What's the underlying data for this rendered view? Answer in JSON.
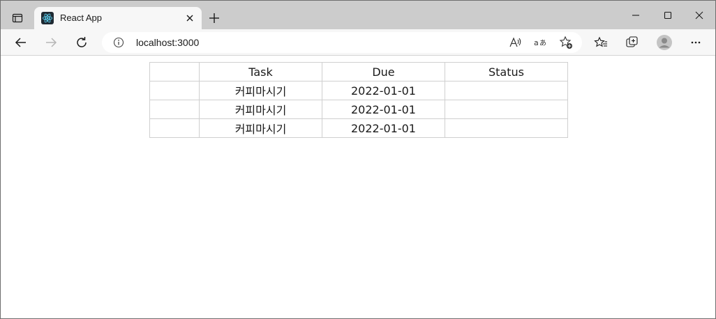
{
  "browser": {
    "tab": {
      "title": "React App",
      "favicon": "react-logo-icon"
    },
    "address": {
      "url": "localhost:3000"
    },
    "accent": "#61dafb",
    "icons": [
      "tab-actions-icon",
      "close-icon",
      "plus-icon",
      "minimize-icon",
      "maximize-icon",
      "window-close-icon",
      "back-icon",
      "forward-icon",
      "refresh-icon",
      "info-icon",
      "read-aloud-icon",
      "translate-icon",
      "add-favorite-icon",
      "favorites-icon",
      "collections-icon",
      "profile-icon",
      "more-icon"
    ]
  },
  "table": {
    "headers": [
      "",
      "Task",
      "Due",
      "Status"
    ],
    "rows": [
      {
        "col0": "",
        "task": "커피마시기",
        "due": "2022-01-01",
        "status": ""
      },
      {
        "col0": "",
        "task": "커피마시기",
        "due": "2022-01-01",
        "status": ""
      },
      {
        "col0": "",
        "task": "커피마시기",
        "due": "2022-01-01",
        "status": ""
      }
    ]
  }
}
